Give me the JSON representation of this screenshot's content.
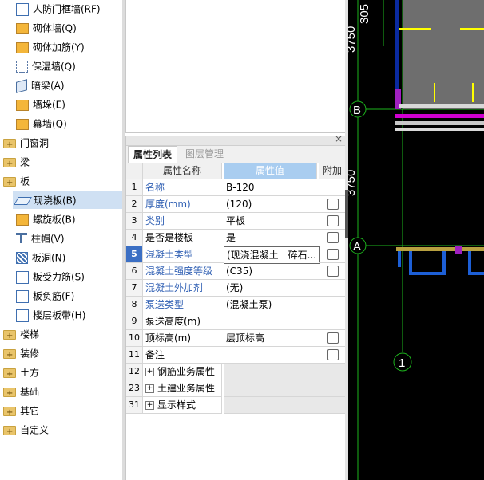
{
  "tree": {
    "items": [
      {
        "label": "人防门框墙(RF)",
        "icon": "door-frame-wall-icon"
      },
      {
        "label": "砌体墙(Q)",
        "icon": "masonry-wall-icon"
      },
      {
        "label": "砌体加筋(Y)",
        "icon": "masonry-rebar-icon"
      },
      {
        "label": "保温墙(Q)",
        "icon": "insulation-wall-icon"
      },
      {
        "label": "暗梁(A)",
        "icon": "hidden-beam-icon"
      },
      {
        "label": "墙垛(E)",
        "icon": "wall-pier-icon"
      },
      {
        "label": "幕墙(Q)",
        "icon": "curtain-wall-icon"
      },
      {
        "label": "门窗洞",
        "icon": "folder-icon"
      },
      {
        "label": "梁",
        "icon": "folder-icon"
      },
      {
        "label": "板",
        "icon": "folder-icon"
      },
      {
        "label": "现浇板(B)",
        "icon": "cast-slab-icon"
      },
      {
        "label": "螺旋板(B)",
        "icon": "spiral-slab-icon"
      },
      {
        "label": "柱帽(V)",
        "icon": "column-cap-icon"
      },
      {
        "label": "板洞(N)",
        "icon": "slab-hole-icon"
      },
      {
        "label": "板受力筋(S)",
        "icon": "slab-main-rebar-icon"
      },
      {
        "label": "板负筋(F)",
        "icon": "slab-negative-rebar-icon"
      },
      {
        "label": "楼层板带(H)",
        "icon": "floor-slab-strip-icon"
      },
      {
        "label": "楼梯",
        "icon": "folder-icon"
      },
      {
        "label": "装修",
        "icon": "folder-icon"
      },
      {
        "label": "土方",
        "icon": "folder-icon"
      },
      {
        "label": "基础",
        "icon": "folder-icon"
      },
      {
        "label": "其它",
        "icon": "folder-icon"
      },
      {
        "label": "自定义",
        "icon": "folder-icon"
      }
    ]
  },
  "props": {
    "tab_active": "属性列表",
    "tab_other": "图层管理",
    "close": "×",
    "headers": {
      "name": "属性名称",
      "value": "属性值",
      "extra": "附加"
    },
    "rows": [
      {
        "num": "1",
        "name": "名称",
        "value": "B-120"
      },
      {
        "num": "2",
        "name": "厚度(mm)",
        "value": "(120)"
      },
      {
        "num": "3",
        "name": "类别",
        "value": "平板"
      },
      {
        "num": "4",
        "name": "是否是楼板",
        "value": "是"
      },
      {
        "num": "5",
        "name": "混凝土类型",
        "value": "(现浇混凝土　碎石..."
      },
      {
        "num": "6",
        "name": "混凝土强度等级",
        "value": "(C35)"
      },
      {
        "num": "7",
        "name": "混凝土外加剂",
        "value": "(无)"
      },
      {
        "num": "8",
        "name": "泵送类型",
        "value": "(混凝土泵)"
      },
      {
        "num": "9",
        "name": "泵送高度(m)",
        "value": ""
      },
      {
        "num": "10",
        "name": "顶标高(m)",
        "value": "层顶标高"
      },
      {
        "num": "11",
        "name": "备注",
        "value": ""
      },
      {
        "num": "12",
        "name": "钢筋业务属性",
        "value": ""
      },
      {
        "num": "23",
        "name": "土建业务属性",
        "value": ""
      },
      {
        "num": "31",
        "name": "显示样式",
        "value": ""
      }
    ]
  },
  "cad": {
    "dim_305": "305",
    "dim_3750_top": "3750",
    "dim_3750_mid": "3750",
    "axis_b": "B",
    "axis_a": "A",
    "axis_1": "1"
  }
}
